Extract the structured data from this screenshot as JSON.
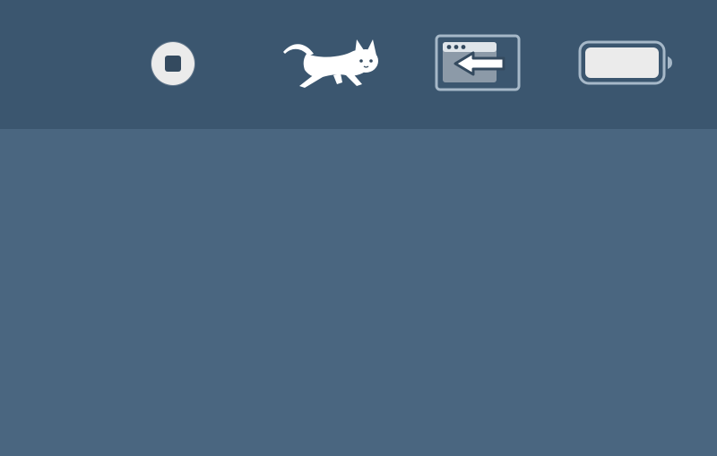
{
  "menubar": {
    "items": [
      {
        "icon": "stop-record-icon",
        "kind": "recording-indicator"
      },
      {
        "icon": "running-cat-icon",
        "kind": "runcat-cpu-monitor"
      },
      {
        "icon": "window-arrow-left-icon",
        "kind": "window-switcher"
      },
      {
        "icon": "battery-icon",
        "kind": "battery-status",
        "level": 1.0
      }
    ]
  },
  "colors": {
    "menubar_bg": "#3b566f",
    "desktop_bg": "#4a6680",
    "icon_light": "#ebebeb",
    "icon_outline": "#a6b8c8",
    "window_fill": "#8c9aa8"
  }
}
